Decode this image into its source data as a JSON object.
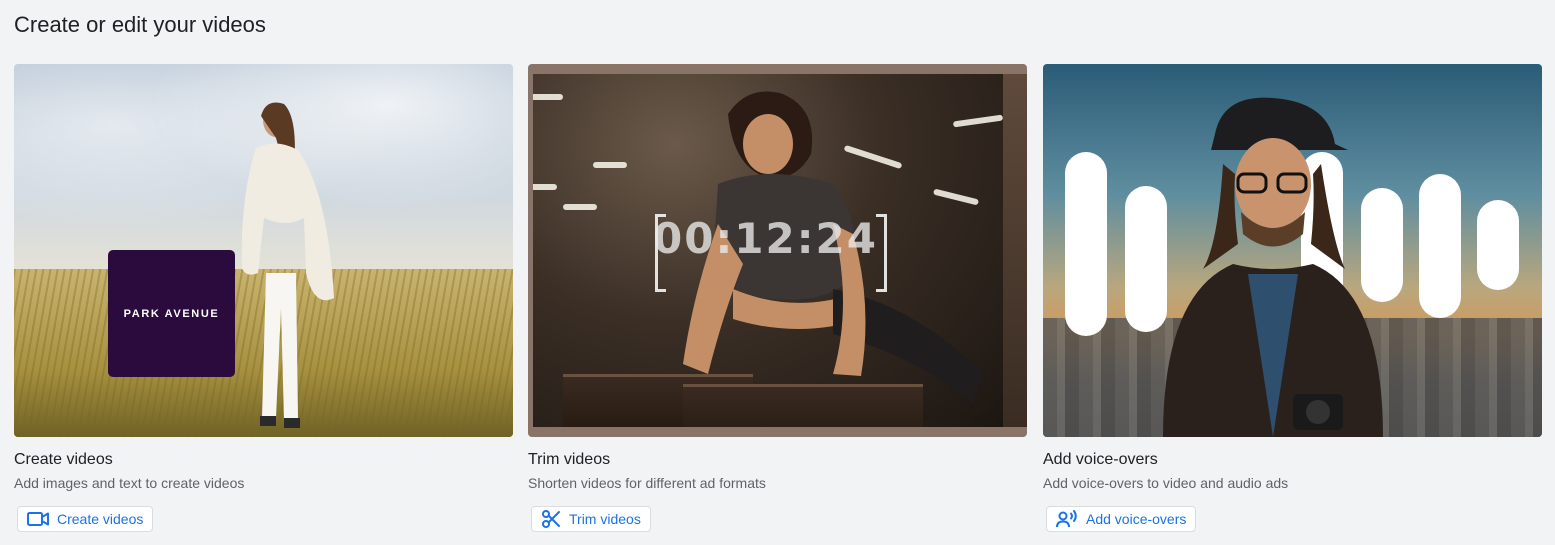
{
  "section": {
    "title": "Create or edit your videos"
  },
  "cards": [
    {
      "title": "Create videos",
      "description": "Add images and text to create videos",
      "button_label": "Create videos",
      "icon": "video-camera-icon",
      "thumbnail_overlay_text": "PARK AVENUE"
    },
    {
      "title": "Trim videos",
      "description": "Shorten videos for different ad formats",
      "button_label": "Trim videos",
      "icon": "scissors-icon",
      "thumbnail_overlay_text": "00:12:24"
    },
    {
      "title": "Add voice-overs",
      "description": "Add voice-overs to video and audio ads",
      "button_label": "Add voice-overs",
      "icon": "voice-person-icon"
    }
  ],
  "colors": {
    "accent": "#1a73e8",
    "background": "#f1f3f4",
    "brand_tile": "#2b0a3d"
  }
}
